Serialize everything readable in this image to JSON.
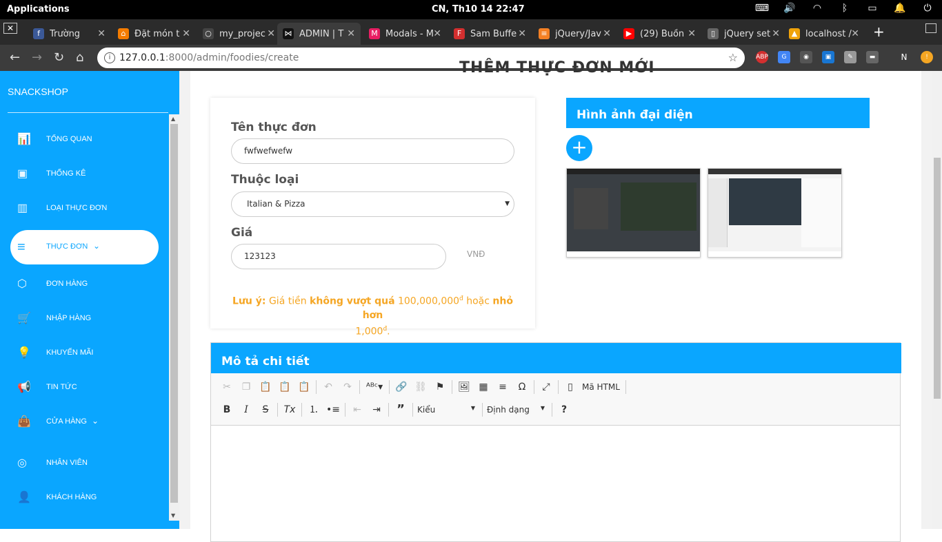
{
  "os": {
    "apps_label": "Applications",
    "clock": "CN, Th10 14    22:47"
  },
  "browser": {
    "tabs": [
      {
        "label": "Trường",
        "fav_color": "#3b5998",
        "fav_glyph": "f"
      },
      {
        "label": "Đặt món t",
        "fav_color": "#f57c00",
        "fav_glyph": "⌂"
      },
      {
        "label": "my_projec",
        "fav_color": "#444",
        "fav_glyph": "○"
      },
      {
        "label": "ADMIN | T",
        "fav_color": "#111",
        "fav_glyph": "⋈"
      },
      {
        "label": "Modals - M",
        "fav_color": "#e91e63",
        "fav_glyph": "M"
      },
      {
        "label": "Sam Buffe",
        "fav_color": "#d32f2f",
        "fav_glyph": "F"
      },
      {
        "label": "jQuery/Jav",
        "fav_color": "#f48024",
        "fav_glyph": "≡"
      },
      {
        "label": "(29) Buồn",
        "fav_color": "#ff0000",
        "fav_glyph": "▶"
      },
      {
        "label": "jQuery set",
        "fav_color": "#666",
        "fav_glyph": "▯"
      },
      {
        "label": "localhost /",
        "fav_color": "#f0a30a",
        "fav_glyph": "▲"
      }
    ],
    "url_host": "127.0.0.1",
    "url_path": ":8000/admin/foodies/create",
    "profile_initial": "N"
  },
  "sidebar": {
    "brand": "SNACKSHOP",
    "items": [
      {
        "label": "TỔNG QUAN",
        "icon": "bar-chart-icon"
      },
      {
        "label": "THỐNG KÊ",
        "icon": "money-icon"
      },
      {
        "label": "LOẠI THỰC ĐƠN",
        "icon": "map-icon"
      },
      {
        "label": "THỰC ĐƠN",
        "icon": "menu-icon"
      },
      {
        "label": "ĐƠN HÀNG",
        "icon": "box-icon"
      },
      {
        "label": "NHẬP HÀNG",
        "icon": "cart-icon"
      },
      {
        "label": "KHUYẾN MÃI",
        "icon": "bulb-icon"
      },
      {
        "label": "TIN TỨC",
        "icon": "megaphone-icon"
      },
      {
        "label": "CỬA HÀNG",
        "icon": "bag-icon"
      },
      {
        "label": "NHÂN VIÊN",
        "icon": "user-circle-icon"
      },
      {
        "label": "KHÁCH HÀNG",
        "icon": "user-icon"
      }
    ]
  },
  "page": {
    "title": "THÊM THỰC ĐƠN MỚI",
    "form": {
      "name_label": "Tên thực đơn",
      "name_value": "fwfwefwefw",
      "category_label": "Thuộc loại",
      "category_value": "Italian & Pizza",
      "price_label": "Giá",
      "price_value": "123123",
      "price_unit": "VNĐ",
      "note_prefix": "Lưu ý:",
      "note_t1": " Giá tiền ",
      "note_b1": "không vượt quá",
      "note_t2": " 100,000,000",
      "note_sup": "đ",
      "note_t3": " hoặc ",
      "note_b2": "nhỏ hơn",
      "note_t4": "1,000",
      "note_t5": "."
    },
    "image_section": {
      "header": "Hình ảnh đại diện",
      "add_label": "+"
    },
    "description": {
      "header": "Mô tả chi tiết",
      "source_label": "Mã HTML",
      "style_combo": "Kiểu",
      "format_combo": "Định dạng"
    }
  },
  "colors": {
    "accent": "#0aa6ff",
    "warning": "#f5a623"
  }
}
